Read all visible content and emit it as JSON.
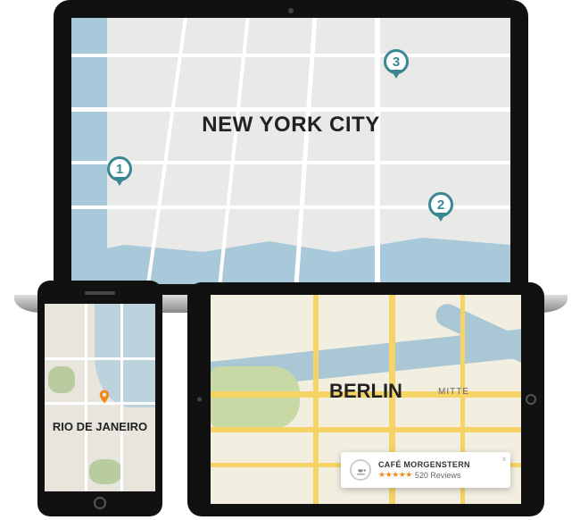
{
  "laptop": {
    "city_label": "NEW YORK CITY",
    "pins": {
      "1": "1",
      "2": "2",
      "3": "3"
    }
  },
  "phone": {
    "city_label": "RIO DE JANEIRO"
  },
  "tablet": {
    "city_label": "BERLIN",
    "district_label": "MITTE",
    "callout": {
      "title": "CAFÉ MORGENSTERN",
      "stars": "★★★★★",
      "reviews": "520 Reviews",
      "close": "x"
    }
  }
}
